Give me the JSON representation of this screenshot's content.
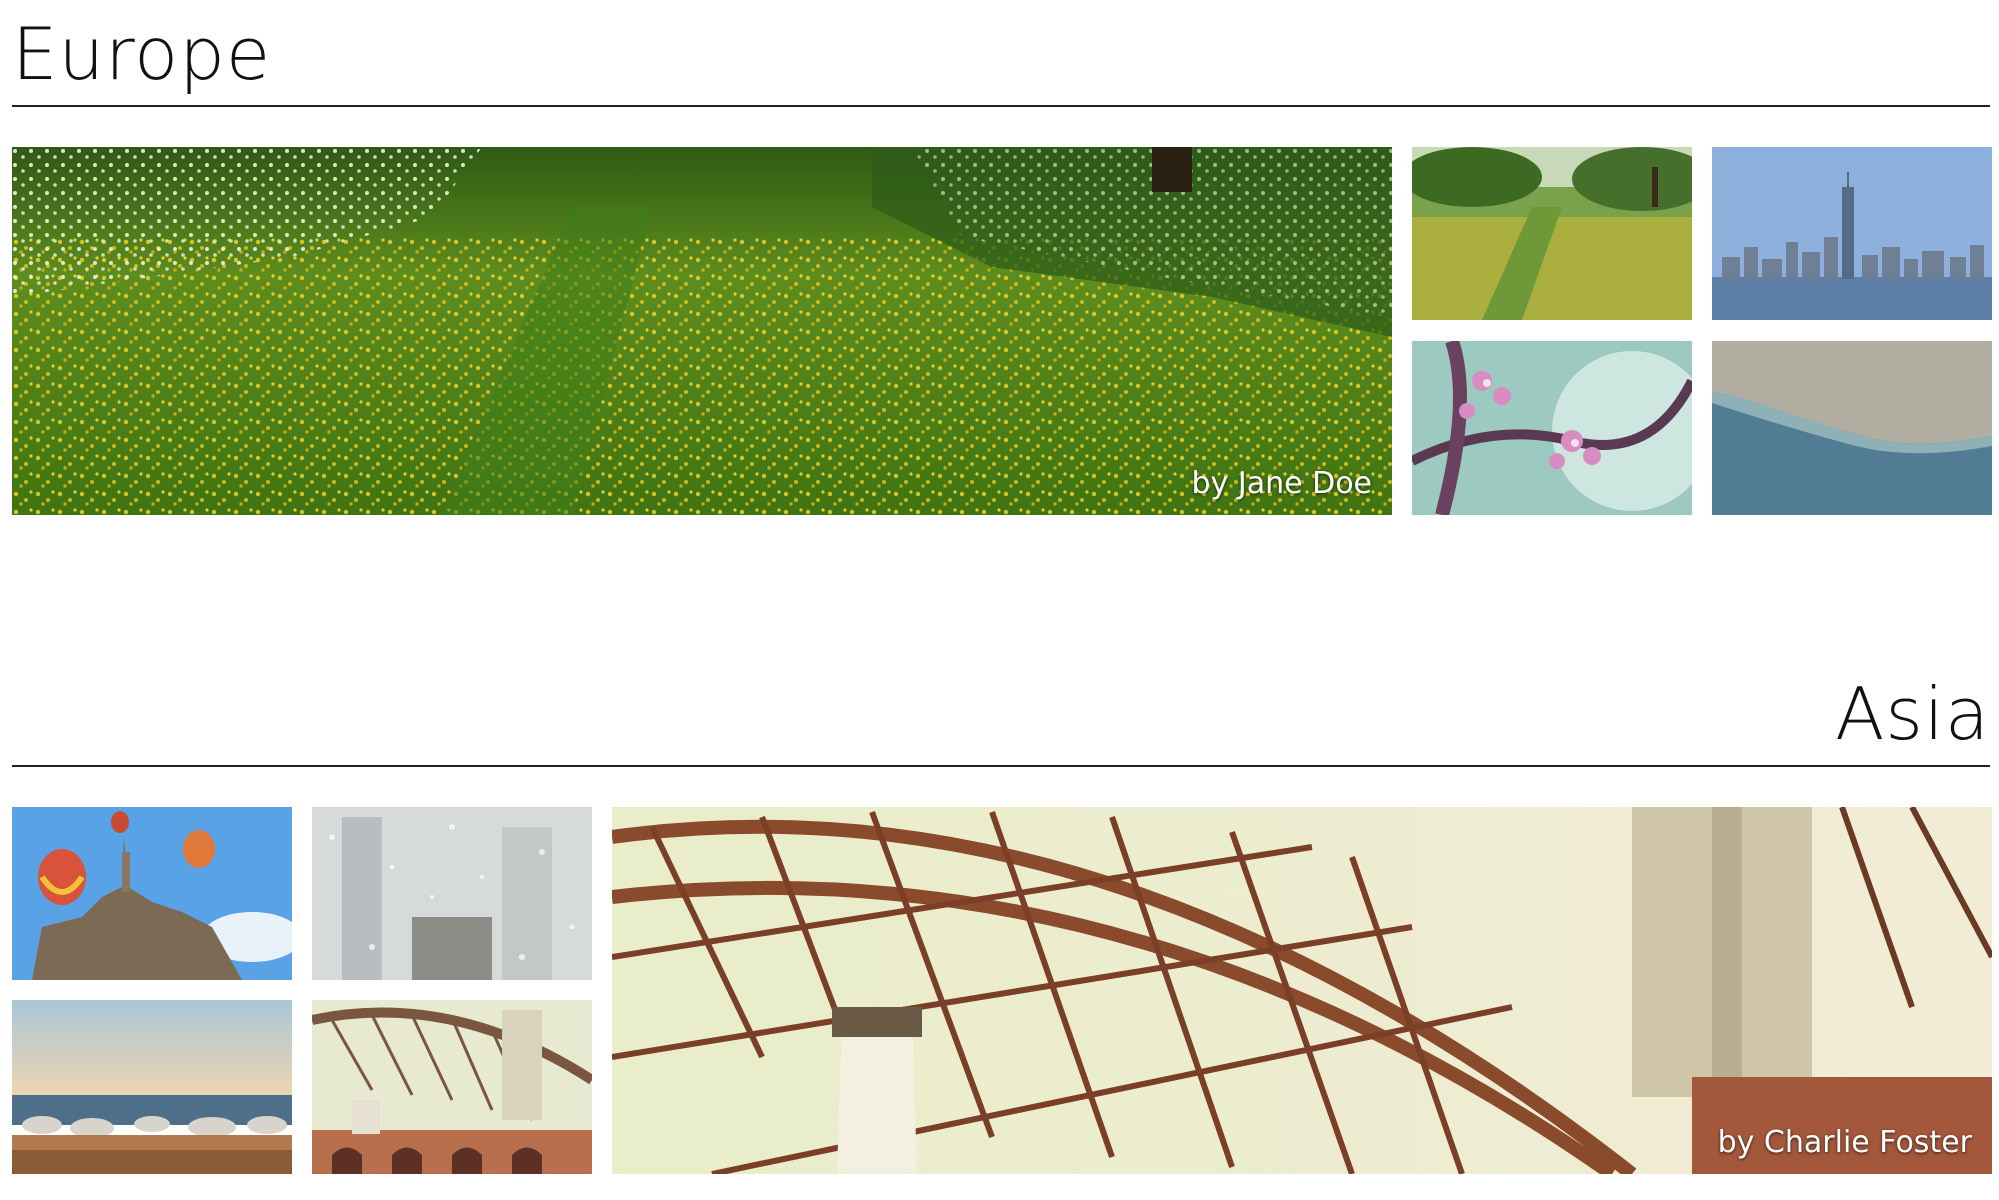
{
  "sections": [
    {
      "title": "Europe",
      "featured_caption": "by Jane Doe",
      "images": [
        "flower-meadow-photo",
        "meadow-path-photo",
        "city-skyline-photo",
        "cherry-blossom-photo",
        "coastline-aerial-photo"
      ]
    },
    {
      "title": "Asia",
      "featured_caption": "by Charlie Foster",
      "images": [
        "castle-balloons-photo",
        "rainy-window-city-photo",
        "rocky-shore-photo",
        "bridge-arch-photo",
        "bridge-steel-closeup-photo"
      ]
    }
  ]
}
